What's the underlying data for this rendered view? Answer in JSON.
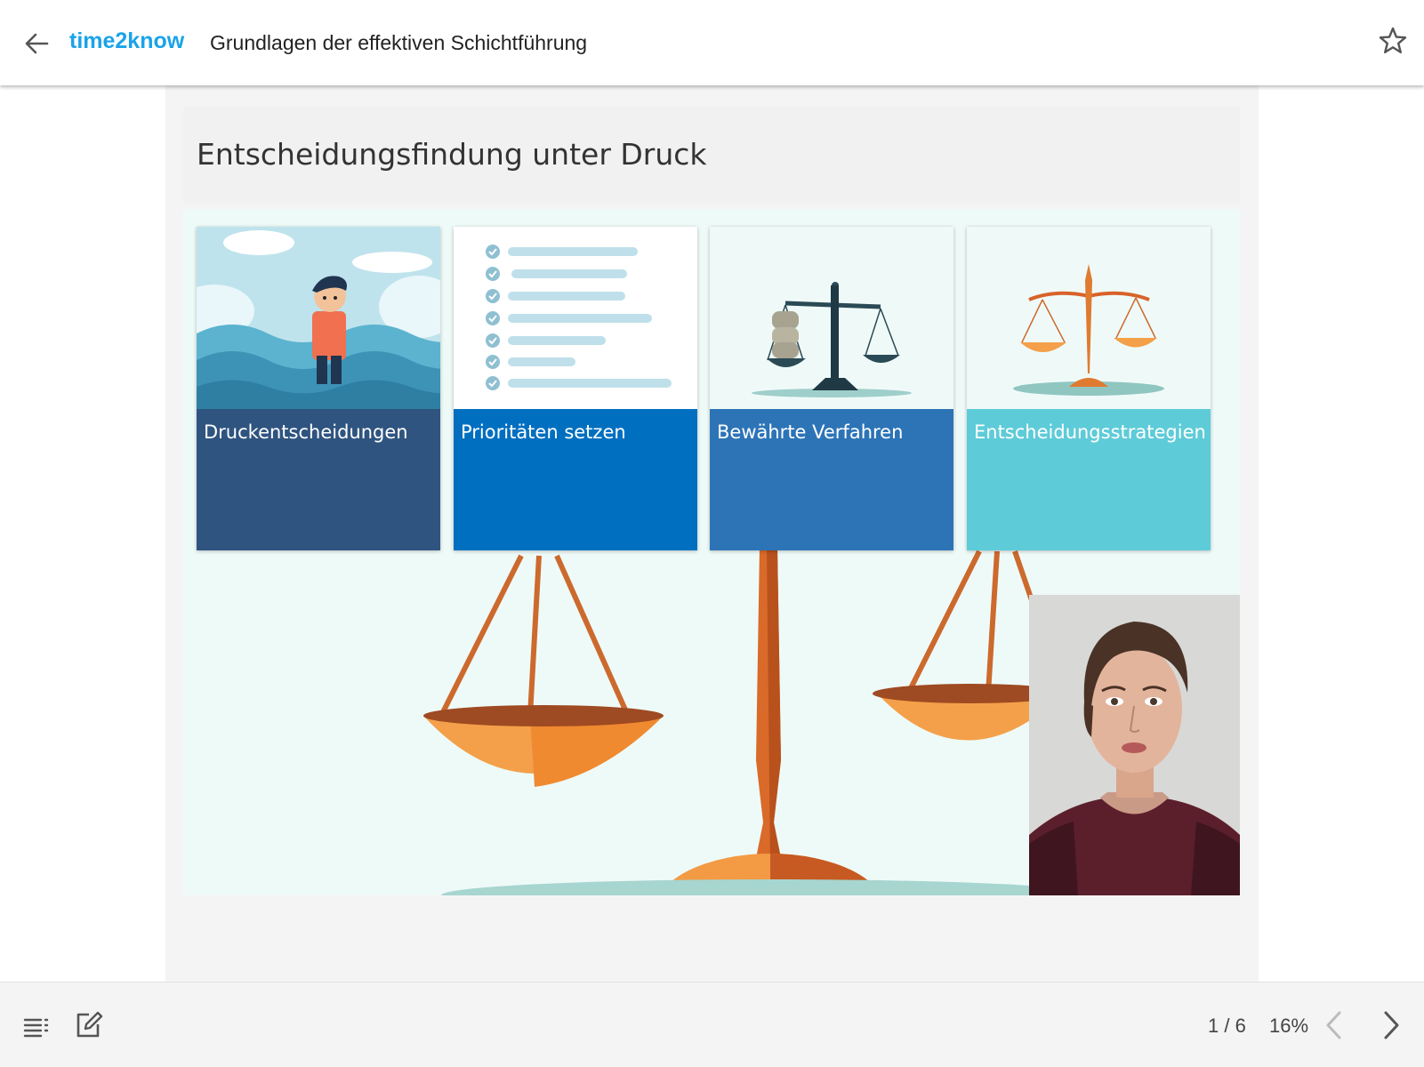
{
  "header": {
    "brand": "time2know",
    "course_title": "Grundlagen der effektiven Schichtführung",
    "back_icon": "arrow-left-icon",
    "favorite_icon": "star-outline-icon"
  },
  "slide": {
    "heading": "Entscheidungsfindung unter Druck",
    "cards": [
      {
        "label": "Druckentscheidungen",
        "icon": "person-in-waves-illustration",
        "color": "#2f5480"
      },
      {
        "label": "Prioritäten setzen",
        "icon": "checklist-illustration",
        "color": "#006fc0"
      },
      {
        "label": "Bewährte Verfahren",
        "icon": "balance-scale-dark-illustration",
        "color": "#2d74b7"
      },
      {
        "label": "Entscheidungsstrategien",
        "icon": "balance-scale-orange-illustration",
        "color": "#5ecbd8"
      }
    ],
    "background_icon": "large-balance-scale-illustration",
    "presenter": "presenter-video-avatar"
  },
  "footer": {
    "toc_icon": "table-of-contents-icon",
    "notes_icon": "edit-note-icon",
    "page_indicator": "1 / 6",
    "progress": "16%",
    "prev_icon": "chevron-left-icon",
    "next_icon": "chevron-right-icon"
  },
  "colors": {
    "brand": "#1aa3e8",
    "card_1": "#2f5480",
    "card_2": "#006fc0",
    "card_3": "#2d74b7",
    "card_4": "#5ecbd8"
  }
}
